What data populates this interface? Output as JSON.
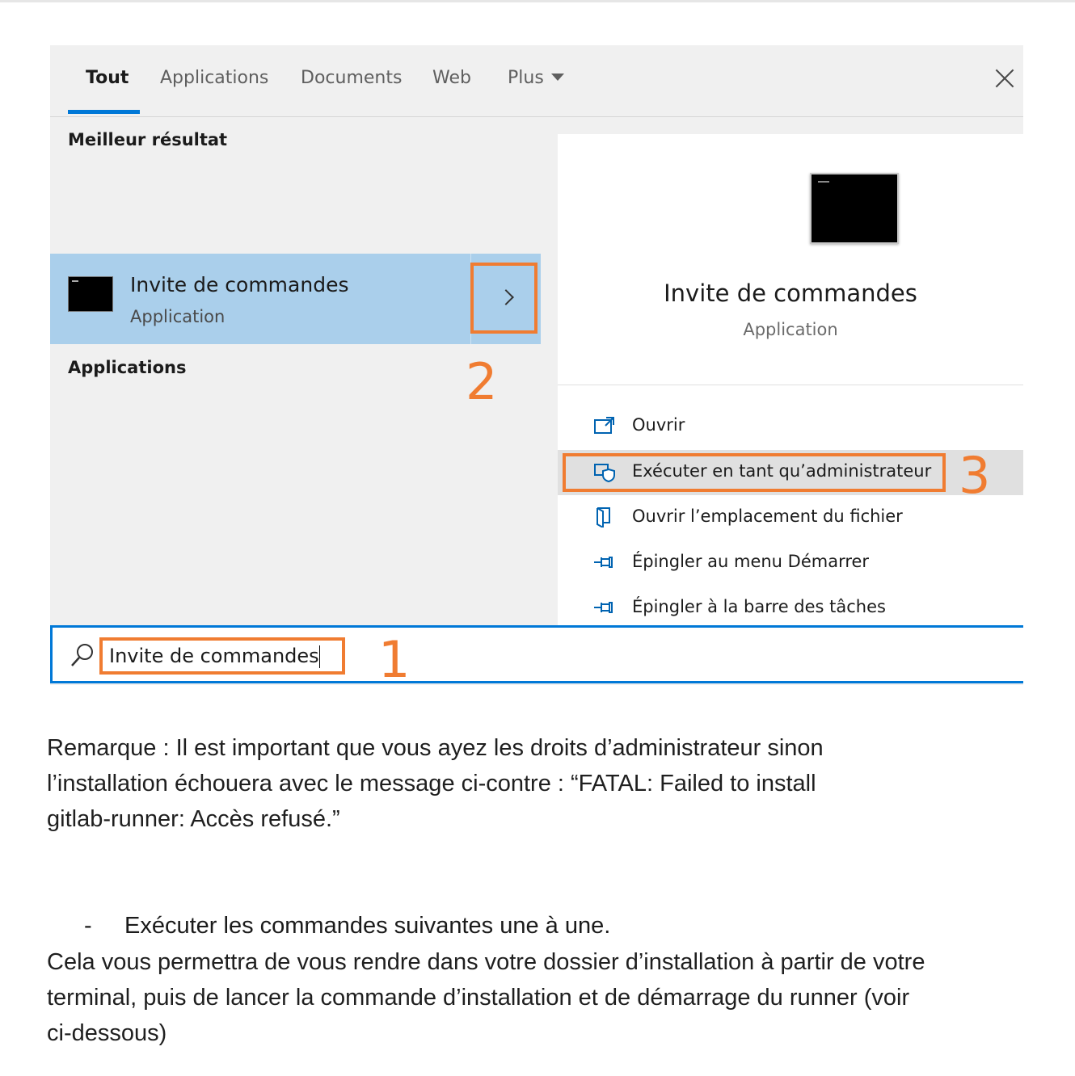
{
  "search_window": {
    "tabs": [
      {
        "label": "Tout",
        "active": true
      },
      {
        "label": "Applications",
        "active": false
      },
      {
        "label": "Documents",
        "active": false
      },
      {
        "label": "Web",
        "active": false
      },
      {
        "label": "Plus",
        "active": false
      }
    ],
    "best_result_heading": "Meilleur résultat",
    "best_result": {
      "title": "Invite de commandes",
      "subtitle": "Application"
    },
    "applications_heading": "Applications",
    "detail": {
      "title": "Invite de commandes",
      "subtitle": "Application"
    },
    "actions": [
      {
        "label": "Ouvrir",
        "icon": "open-window-icon"
      },
      {
        "label": "Exécuter en tant qu’administrateur",
        "icon": "shield-admin-icon",
        "highlighted": true
      },
      {
        "label": "Ouvrir l’emplacement du fichier",
        "icon": "file-location-icon"
      },
      {
        "label": "Épingler au menu Démarrer",
        "icon": "pin-icon"
      },
      {
        "label": "Épingler à la barre des tâches",
        "icon": "pin-icon"
      }
    ],
    "search_value": "Invite de commandes",
    "steps": [
      "1",
      "2",
      "3"
    ],
    "accent_color": "#0078d7",
    "annotation_color": "#f07c31",
    "selected_row_color": "#aacfeb"
  },
  "document": {
    "note_lines": [
      "Remarque : Il est important que vous ayez les droits d’administrateur sinon",
      "l’installation échouera avec le message ci-contre : “FATAL: Failed to install",
      "gitlab-runner: Accès refusé.”"
    ],
    "bullet_dash": "-",
    "bullet_text": "Exécuter les commandes suivantes une à une.",
    "para_lines": [
      "Cela vous permettra de vous rendre dans votre dossier d’installation à partir de votre",
      "terminal, puis de lancer la commande d’installation et de démarrage du runner (voir",
      "ci-dessous)"
    ]
  }
}
